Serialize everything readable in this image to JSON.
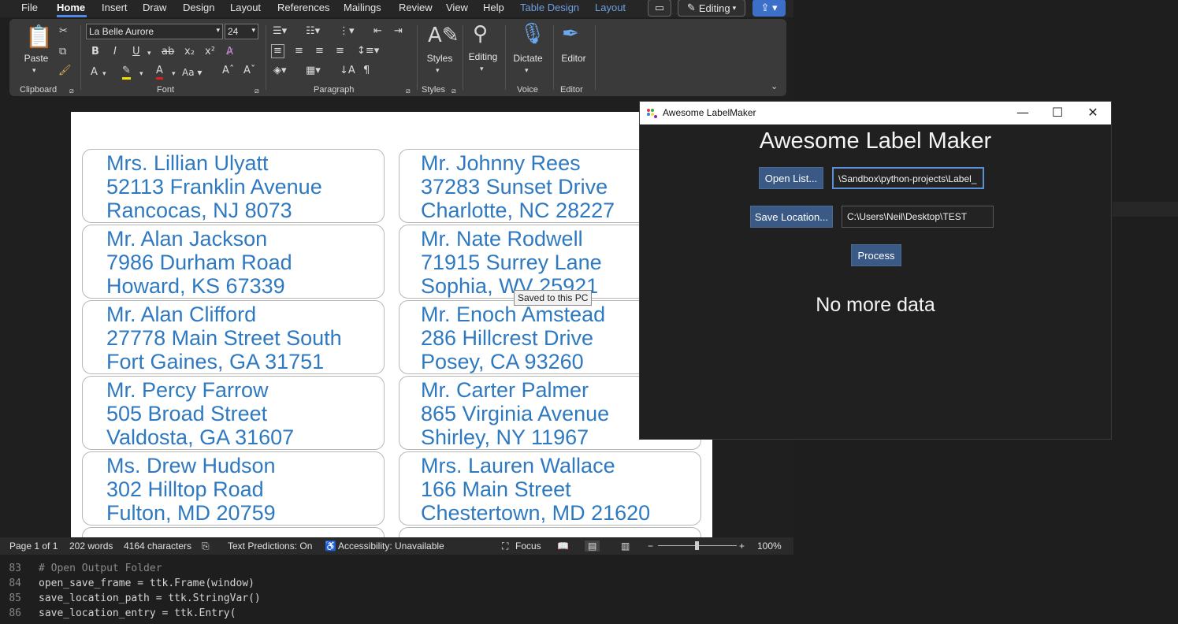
{
  "menu": {
    "items": [
      "File",
      "Home",
      "Insert",
      "Draw",
      "Design",
      "Layout",
      "References",
      "Mailings",
      "Review",
      "View",
      "Help",
      "Table Design",
      "Layout"
    ],
    "active": "Home",
    "editing_label": "Editing"
  },
  "ribbon": {
    "font_name": "La Belle Aurore",
    "font_size": "24",
    "paste_label": "Paste",
    "styles_label": "Styles",
    "editing_label": "Editing",
    "dictate_label": "Dictate",
    "editor_label": "Editor",
    "groups": {
      "clipboard": "Clipboard",
      "font": "Font",
      "paragraph": "Paragraph",
      "styles": "Styles",
      "voice": "Voice",
      "editor": "Editor"
    }
  },
  "labels": [
    [
      "Mrs. Lillian Ulyatt",
      "52113 Franklin Avenue",
      "Rancocas, NJ 8073"
    ],
    [
      "Mr. Johnny Rees",
      "37283 Sunset Drive",
      "Charlotte, NC 28227"
    ],
    [
      "Mr. Alan Jackson",
      "7986 Durham Road",
      "Howard, KS 67339"
    ],
    [
      "Mr. Nate Rodwell",
      "71915 Surrey Lane",
      "Sophia, WV 25921"
    ],
    [
      "Mr. Alan Clifford",
      "27778 Main Street South",
      "Fort Gaines, GA 31751"
    ],
    [
      "Mr. Enoch Amstead",
      "286 Hillcrest Drive",
      "Posey, CA 93260"
    ],
    [
      "Mr. Percy Farrow",
      "505 Broad Street",
      "Valdosta, GA 31607"
    ],
    [
      "Mr. Carter Palmer",
      "865 Virginia Avenue",
      "Shirley, NY 11967"
    ],
    [
      "Ms. Drew Hudson",
      "302 Hilltop Road",
      "Fulton, MD 20759"
    ],
    [
      "Mrs. Lauren Wallace",
      "166 Main Street",
      "Chestertown, MD 21620"
    ]
  ],
  "tooltip": "Saved to this PC",
  "status": {
    "page": "Page 1 of 1",
    "words": "202 words",
    "chars": "4164 characters",
    "predictions": "Text Predictions: On",
    "accessibility": "Accessibility: Unavailable",
    "focus": "Focus",
    "zoom": "100%"
  },
  "code": {
    "lines": [
      {
        "num": "83",
        "text": "# Open Output Folder"
      },
      {
        "num": "84",
        "text": "open_save_frame = ttk.Frame(window)"
      },
      {
        "num": "85",
        "text": "save_location_path = ttk.StringVar()"
      },
      {
        "num": "86",
        "text": "save_location_entry = ttk.Entry("
      }
    ]
  },
  "labelmaker": {
    "title": "Awesome LabelMaker",
    "heading": "Awesome Label Maker",
    "open_list_label": "Open List...",
    "open_list_path": "\\Sandbox\\python-projects\\Label_",
    "save_location_label": "Save Location...",
    "save_location_path": "C:\\Users\\Neil\\Desktop\\TEST",
    "process_label": "Process",
    "status_text": "No more data"
  },
  "colors": {
    "label_text": "#2f79c0",
    "accent": "#4f8ae8",
    "button": "#3a5a85"
  }
}
